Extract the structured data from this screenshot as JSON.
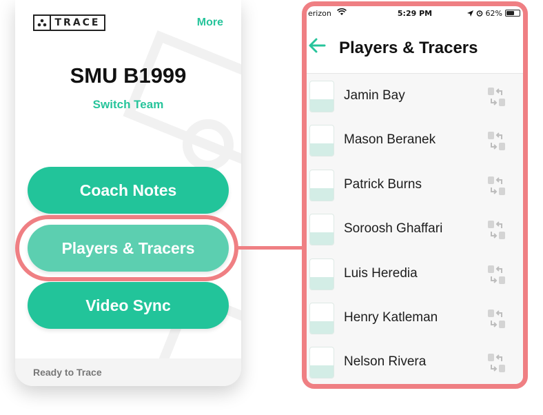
{
  "left_screen": {
    "logo_text": "TRACE",
    "more_label": "More",
    "team_name": "SMU B1999",
    "switch_team_label": "Switch Team",
    "buttons": {
      "coach_notes": "Coach Notes",
      "players_tracers": "Players & Tracers",
      "video_sync": "Video Sync"
    },
    "status_text": "Ready to Trace"
  },
  "right_screen": {
    "status_bar": {
      "carrier": "erizon",
      "time": "5:29 PM",
      "battery": "62%"
    },
    "title": "Players & Tracers",
    "players": [
      {
        "name": "Jamin Bay"
      },
      {
        "name": "Mason Beranek"
      },
      {
        "name": "Patrick Burns"
      },
      {
        "name": "Soroosh Ghaffari"
      },
      {
        "name": "Luis Heredia"
      },
      {
        "name": "Henry Katleman"
      },
      {
        "name": "Nelson Rivera"
      }
    ]
  },
  "colors": {
    "accent_green": "#22c49a",
    "selected_green": "#5ccfb0",
    "highlight_pink": "#ef7f83"
  }
}
